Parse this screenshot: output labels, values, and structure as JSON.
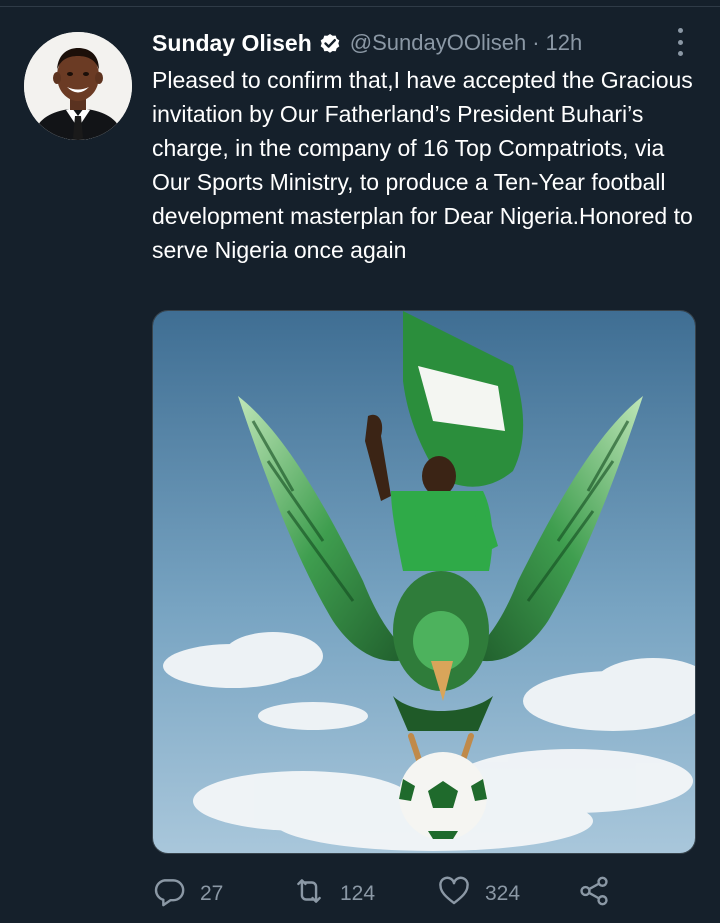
{
  "tweet": {
    "author_name": "Sunday Oliseh",
    "handle": "@SundayOOliseh",
    "separator": "·",
    "time": "12h",
    "text": "Pleased to confirm that,I have accepted the Gracious invitation by Our Fatherland’s President Buhari’s charge, in the company of 16 Top Compatriots, via Our Sports Ministry, to produce a Ten-Year football development masterplan for Dear Nigeria.Honored to serve Nigeria once again"
  },
  "actions": {
    "replies": "27",
    "retweets": "124",
    "likes": "324"
  },
  "icons": {
    "verified": "verified-badge-icon",
    "more": "more-options-icon",
    "reply": "reply-icon",
    "retweet": "retweet-icon",
    "like": "like-icon",
    "share": "share-icon"
  },
  "colors": {
    "background": "#15202b",
    "secondary_text": "#8b98a5",
    "primary_text": "#ffffff",
    "nigeria_green": "#1f8a3a"
  }
}
